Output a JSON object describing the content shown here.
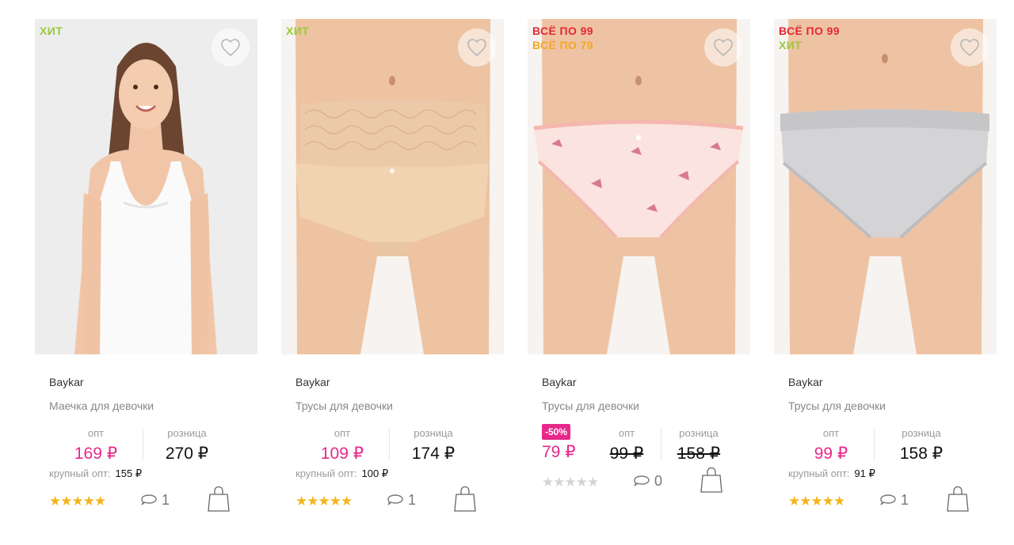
{
  "products": [
    {
      "badges": [
        {
          "text": "ХИТ",
          "kind": "hit"
        }
      ],
      "brand": "Baykar",
      "title": "Маечка для девочки",
      "opt_label": "опт",
      "opt_price": "169 ₽",
      "retail_label": "розница",
      "retail_price": "270 ₽",
      "bulk_label": "крупный опт:",
      "bulk_price": "155 ₽",
      "rating": 5,
      "comments": "1",
      "image": "girl-tank-top"
    },
    {
      "badges": [
        {
          "text": "ХИТ",
          "kind": "hit"
        }
      ],
      "brand": "Baykar",
      "title": "Трусы для девочки",
      "opt_label": "опт",
      "opt_price": "109 ₽",
      "retail_label": "розница",
      "retail_price": "174 ₽",
      "bulk_label": "крупный опт:",
      "bulk_price": "100 ₽",
      "rating": 5,
      "comments": "1",
      "image": "beige-lace-briefs"
    },
    {
      "badges": [
        {
          "text": "ВСЁ ПО 99",
          "kind": "all99"
        },
        {
          "text": "ВСЁ ПО 79",
          "kind": "all79"
        }
      ],
      "brand": "Baykar",
      "title": "Трусы для девочки",
      "sale": "-50%",
      "sale_price": "79 ₽",
      "opt_label": "опт",
      "opt_price": "99 ₽",
      "retail_label": "розница",
      "retail_price": "158 ₽",
      "rating": 0,
      "comments": "0",
      "image": "pink-print-briefs"
    },
    {
      "badges": [
        {
          "text": "ВСЁ ПО 99",
          "kind": "all99"
        },
        {
          "text": "ХИТ",
          "kind": "hit"
        }
      ],
      "brand": "Baykar",
      "title": "Трусы для девочки",
      "opt_label": "опт",
      "opt_price": "99 ₽",
      "retail_label": "розница",
      "retail_price": "158 ₽",
      "bulk_label": "крупный опт:",
      "bulk_price": "91 ₽",
      "rating": 5,
      "comments": "1",
      "image": "grey-briefs"
    }
  ],
  "stars_glyph": "★★★★★",
  "colors": {
    "hit": "#9bc93b",
    "all99": "#e52832",
    "all79": "#f5a623",
    "price_pink": "#e8288a",
    "star_gold": "#f5b41b"
  }
}
